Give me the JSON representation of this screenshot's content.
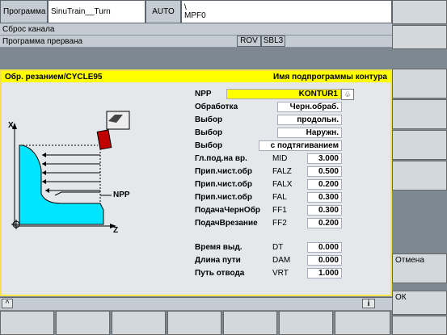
{
  "header": {
    "program_label": "Программа",
    "program_name": "SinuTrain__Turn",
    "mode": "AUTO",
    "path_sep": "\\",
    "file": "MPF0"
  },
  "status": {
    "channel": "Сброс канала",
    "program_state": "Программа прервана",
    "rov": "ROV",
    "sbl": "SBL3"
  },
  "panel": {
    "title": "Обр. резанием/CYCLE95",
    "subtitle": "Имя подпрограммы контура",
    "diagram": {
      "x_label": "X",
      "z_label": "Z",
      "npp_label": "NPP"
    },
    "fields": [
      {
        "label": "NPP",
        "code": "",
        "value": "KONTUR1",
        "highlight": true
      },
      {
        "label": "Обработка",
        "code": "",
        "value": "Черн.обраб."
      },
      {
        "label": "Выбор",
        "code": "",
        "value": "продольн."
      },
      {
        "label": "Выбор",
        "code": "",
        "value": "Наружн."
      },
      {
        "label": "Выбор",
        "code": "",
        "value": "с подтягиванием"
      },
      {
        "label": "Гл.под.на вр.",
        "code": "MID",
        "value": "3.000"
      },
      {
        "label": "Прип.чист.обр",
        "code": "FALZ",
        "value": "0.500"
      },
      {
        "label": "Прип.чист.обр",
        "code": "FALX",
        "value": "0.200"
      },
      {
        "label": "Прип.чист.обр",
        "code": "FAL",
        "value": "0.300"
      },
      {
        "label": "ПодачаЧернОбр",
        "code": "FF1",
        "value": "0.300"
      },
      {
        "label": "ПодачВрезание",
        "code": "FF2",
        "value": "0.200"
      },
      {
        "label": "Время выд.",
        "code": "DT",
        "value": "0.000"
      },
      {
        "label": "Длина пути",
        "code": "DAM",
        "value": "0.000"
      },
      {
        "label": "Путь отвода",
        "code": "VRT",
        "value": "1.000"
      }
    ]
  },
  "softkeys": {
    "right": [
      "",
      "",
      "",
      "",
      "",
      "",
      "Отмена",
      "ОК"
    ]
  },
  "bottom": {
    "up_arrow": "^",
    "info": "i"
  },
  "colors": {
    "accent": "#ffff00",
    "frame": "#7e8890",
    "part": "#00e5ff"
  }
}
